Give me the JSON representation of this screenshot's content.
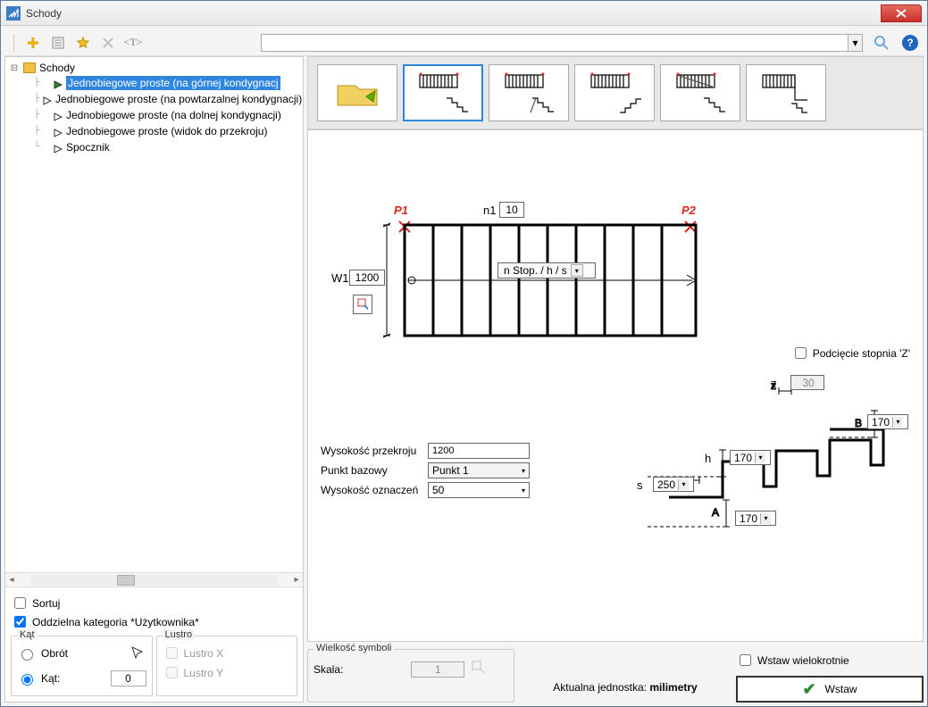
{
  "window": {
    "title": "Schody"
  },
  "tree": {
    "root": "Schody",
    "items": [
      "Jednobiegowe proste (na górnej kondygnacj",
      "Jednobiegowe proste (na powtarzalnej kondygnacji)",
      "Jednobiegowe proste (na dolnej kondygnacji)",
      "Jednobiegowe proste (widok do przekroju)",
      "Spocznik"
    ],
    "selected_index": 0
  },
  "left_options": {
    "sort": {
      "label": "Sortuj",
      "checked": false
    },
    "separate_category": {
      "label": "Oddzielna kategoria *Użytkownika*",
      "checked": true
    }
  },
  "angle": {
    "title": "Kąt",
    "rotate_label": "Obrót",
    "angle_label": "Kąt:",
    "angle_value": "0",
    "selected": "angle"
  },
  "mirror": {
    "title": "Lustro",
    "x_label": "Lustro X",
    "y_label": "Lustro Y"
  },
  "plan": {
    "P1": "P1",
    "P2": "P2",
    "n1_label": "n1",
    "n1_value": "10",
    "W1_label": "W1",
    "W1_value": "1200",
    "combo": "n Stop. / h / s"
  },
  "check_podc": {
    "label": "Podcięcie stopnia 'Z'",
    "checked": false
  },
  "section": {
    "z_label": "z",
    "z_value": "30",
    "B_label": "B",
    "B_value": "170",
    "h_label": "h",
    "h_value": "170",
    "s_label": "s",
    "s_value": "250",
    "A_label": "A",
    "A_value": "170"
  },
  "props": {
    "height": {
      "label": "Wysokość przekroju",
      "value": "1200"
    },
    "base": {
      "label": "Punkt bazowy",
      "value": "Punkt 1"
    },
    "mark": {
      "label": "Wysokość oznaczeń",
      "value": "50"
    }
  },
  "symbol_size": {
    "title": "Wielkość symboli",
    "scale_label": "Skala:",
    "scale_value": "1"
  },
  "unit_line": {
    "prefix": "Aktualna jednostka: ",
    "unit": "milimetry"
  },
  "insert_multi": {
    "label": "Wstaw wielokrotnie",
    "checked": false
  },
  "insert_btn": "Wstaw"
}
